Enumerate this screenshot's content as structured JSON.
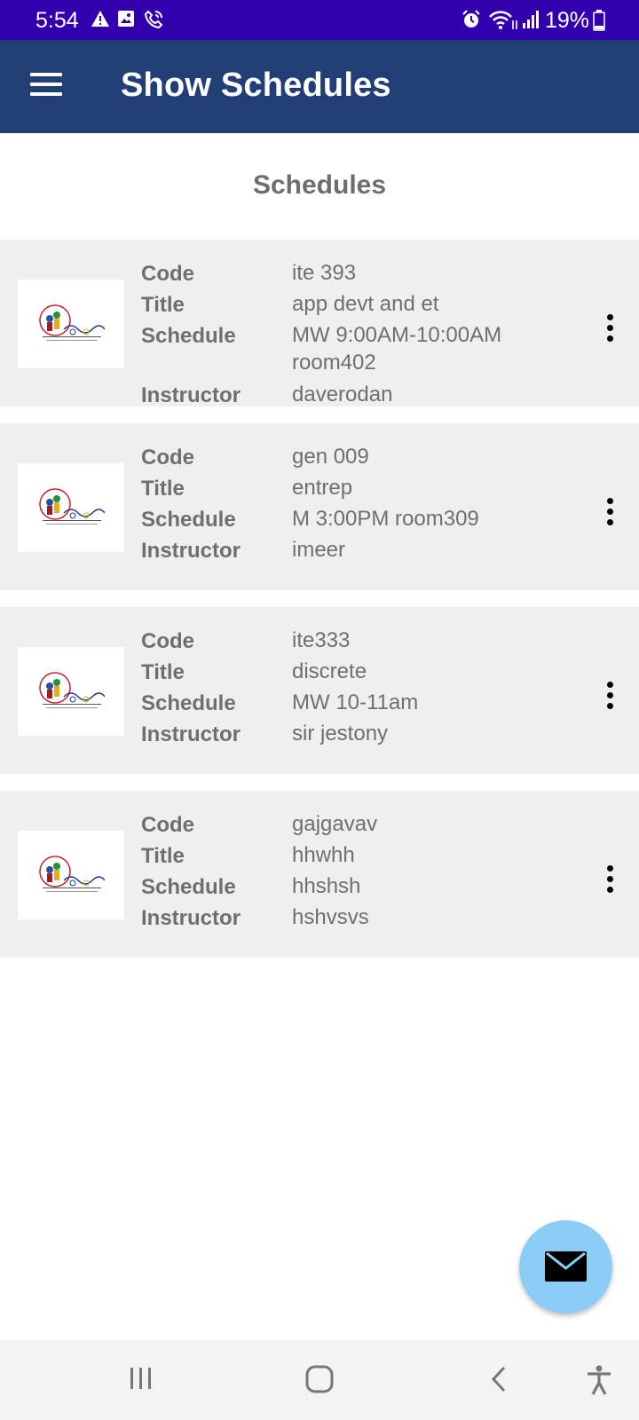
{
  "status_bar": {
    "time": "5:54",
    "battery": "19%",
    "icons": [
      "warning-icon",
      "image-icon",
      "wifi-call-icon",
      "alarm-icon",
      "wifi-icon",
      "signal-icon",
      "battery-icon"
    ]
  },
  "app_bar": {
    "title": "Show Schedules",
    "menu_icon": "hamburger-menu-icon"
  },
  "section": {
    "title": "Schedules"
  },
  "labels": {
    "code": "Code",
    "title": "Title",
    "schedule": "Schedule",
    "instructor": "Instructor"
  },
  "schedules": [
    {
      "code": "ite 393",
      "title": "app devt and et",
      "schedule": "MW 9:00AM-10:00AM room402",
      "instructor": "daverodan"
    },
    {
      "code": "gen 009",
      "title": "entrep",
      "schedule": "M 3:00PM room309",
      "instructor": "imeer"
    },
    {
      "code": "ite333",
      "title": "discrete",
      "schedule": "MW 10-11am",
      "instructor": "sir jestony"
    },
    {
      "code": "gajgavav",
      "title": "hhwhh",
      "schedule": "hhshsh",
      "instructor": "hshvsvs"
    }
  ],
  "fab": {
    "icon": "mail-icon"
  },
  "nav_bar": {
    "icons": [
      "recent-apps-icon",
      "home-icon",
      "back-icon",
      "accessibility-icon"
    ]
  },
  "colors": {
    "status_bar": "#3300b0",
    "app_bar": "#213e75",
    "card_bg": "#efefef",
    "text_gray": "#6f6f6f",
    "fab": "#8bcdf6"
  }
}
